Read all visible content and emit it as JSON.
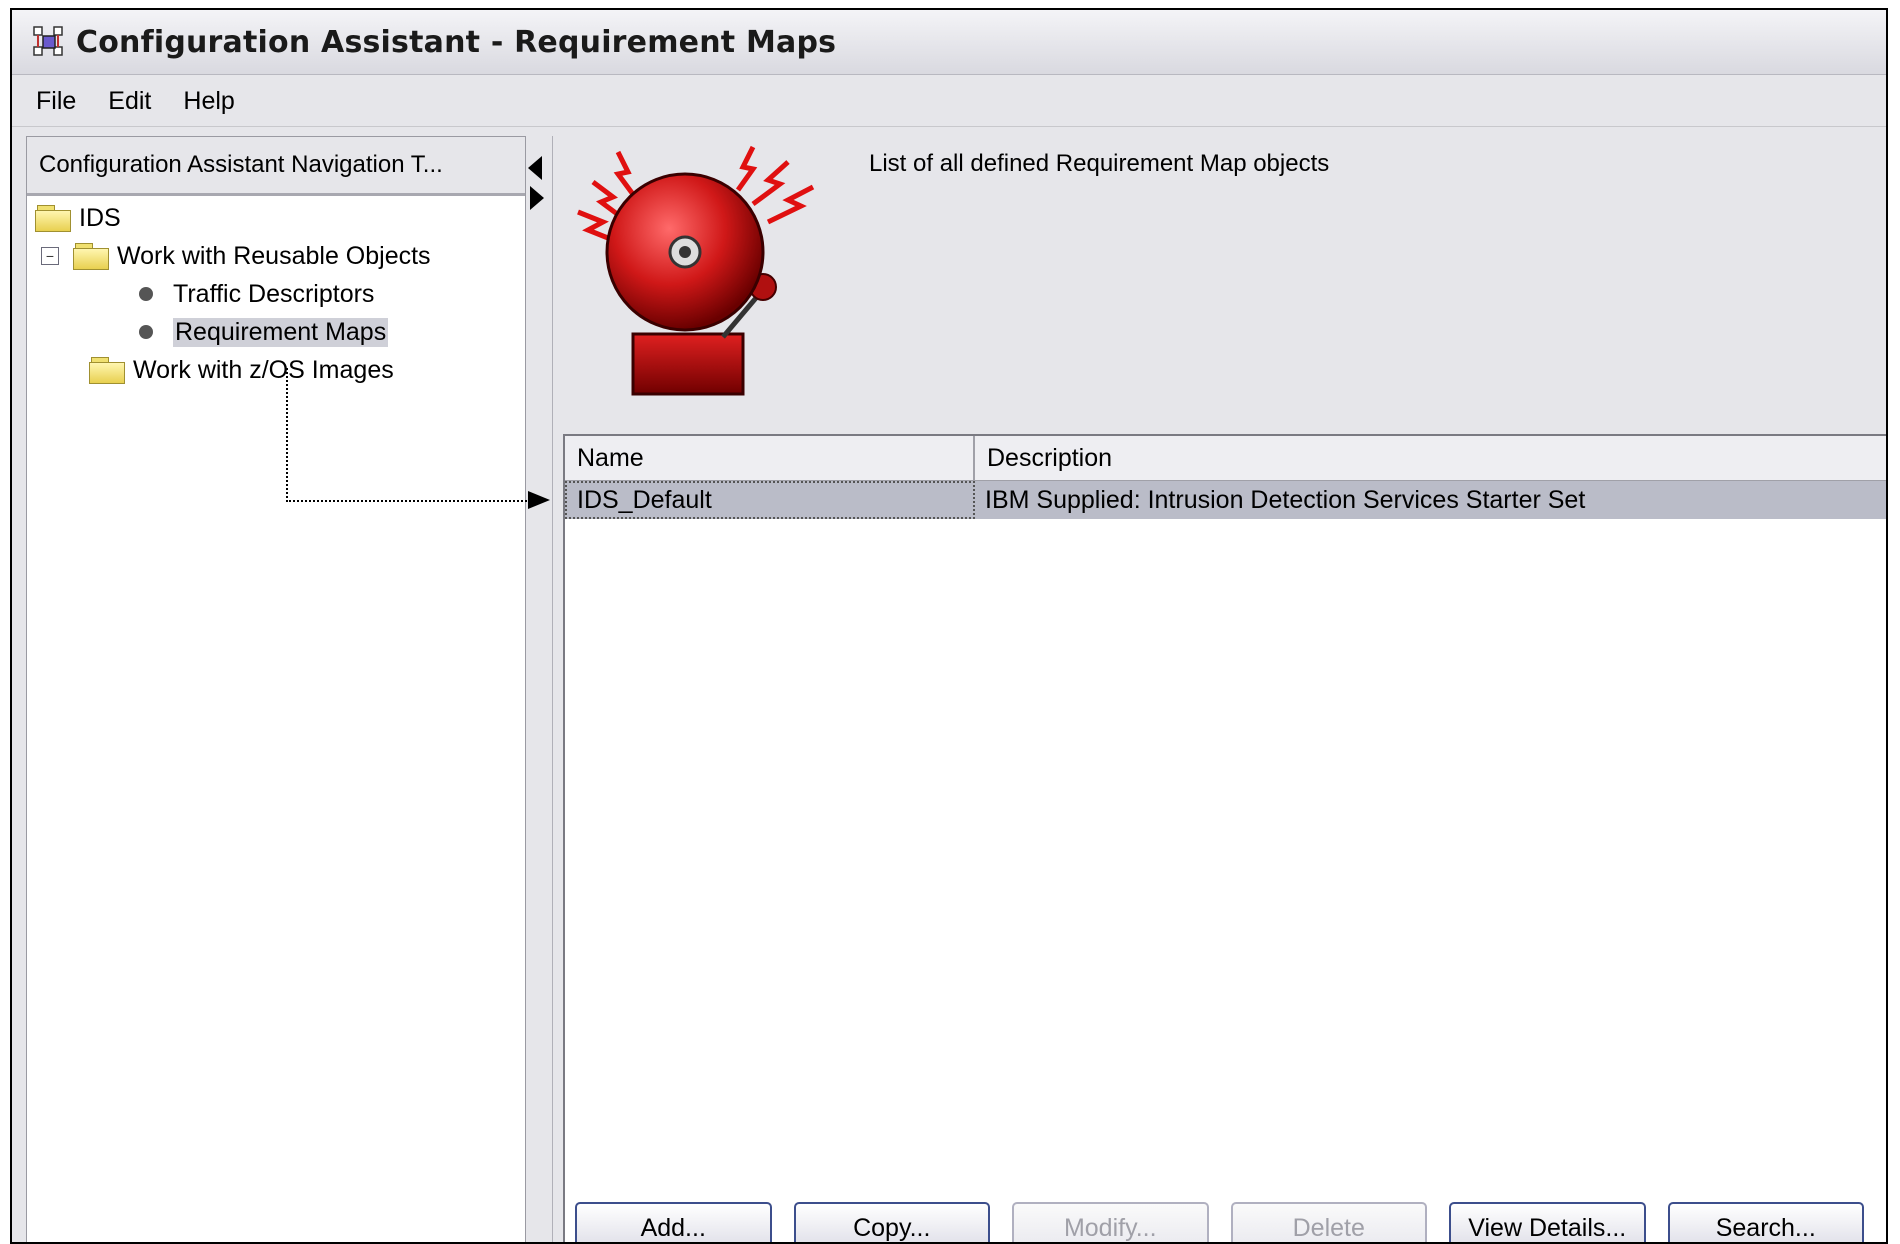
{
  "window": {
    "title": "Configuration Assistant - Requirement Maps"
  },
  "menu": {
    "file": "File",
    "edit": "Edit",
    "help": "Help"
  },
  "navigation": {
    "header": "Configuration Assistant Navigation T...",
    "items": [
      {
        "label": "IDS"
      },
      {
        "label": "Work with Reusable Objects",
        "expander": "−"
      },
      {
        "label": "Traffic Descriptors"
      },
      {
        "label": "Requirement Maps",
        "selected": true
      },
      {
        "label": "Work with z/OS Images"
      }
    ]
  },
  "main": {
    "description": "List of all defined Requirement Map objects",
    "icon": "alarm-bell-icon",
    "table": {
      "columns": [
        "Name",
        "Description"
      ],
      "rows": [
        {
          "name": "IDS_Default",
          "description": "IBM Supplied: Intrusion Detection Services Starter Set",
          "selected": true
        }
      ]
    },
    "buttons": {
      "add": "Add...",
      "copy": "Copy...",
      "modify": "Modify...",
      "delete": "Delete",
      "view_details": "View Details...",
      "search": "Search..."
    }
  },
  "colors": {
    "selection": "#babcc8",
    "button_border": "#3c4e8c",
    "bell_red": "#d01818"
  }
}
